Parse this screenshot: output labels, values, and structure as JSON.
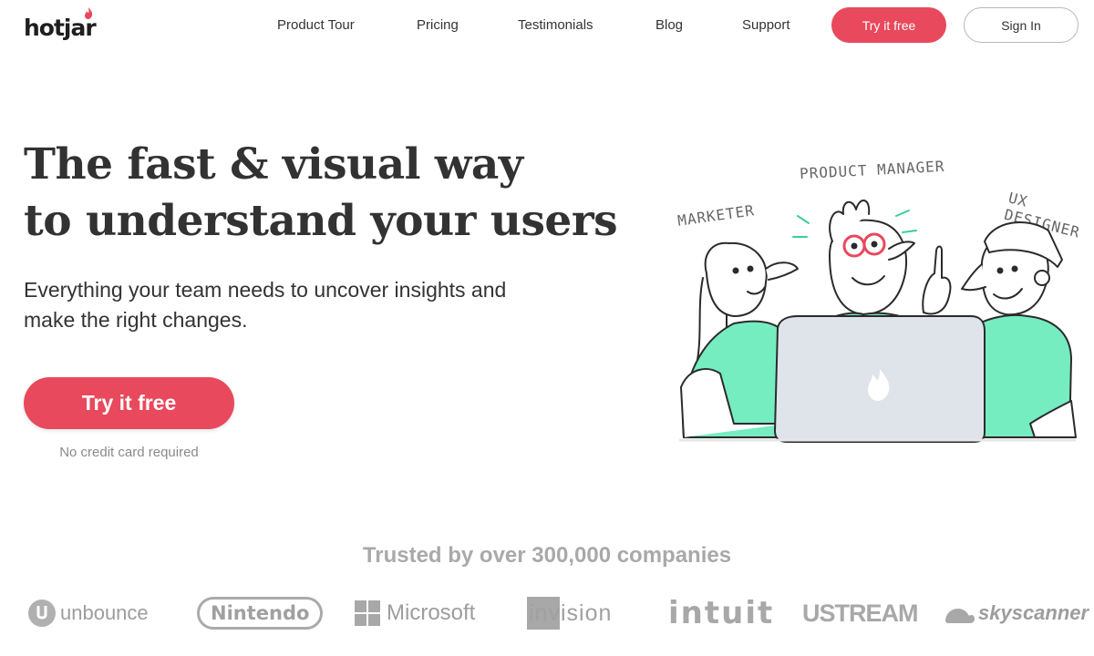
{
  "brand": {
    "name": "hotjar",
    "accent": "#e8495c",
    "highlight": "#76ecc1"
  },
  "nav": {
    "links": [
      "Product Tour",
      "Pricing",
      "Testimonials",
      "Blog",
      "Support"
    ],
    "try_label": "Try it free",
    "signin_label": "Sign In"
  },
  "hero": {
    "headline_line1": "The fast & visual way",
    "headline_to": "to",
    "headline_highlight": "understand your users",
    "subhead": "Everything your team needs to uncover insights and make the right changes.",
    "cta_label": "Try it free",
    "cta_note": "No credit card required"
  },
  "illustration": {
    "labels": [
      "MARKETER",
      "PRODUCT MANAGER",
      "UX DESIGNER"
    ]
  },
  "trust": {
    "title": "Trusted by over 300,000 companies",
    "logos": [
      "unbounce",
      "Nintendo",
      "Microsoft",
      "invision",
      "intuit",
      "USTREAM",
      "skyscanner"
    ]
  }
}
